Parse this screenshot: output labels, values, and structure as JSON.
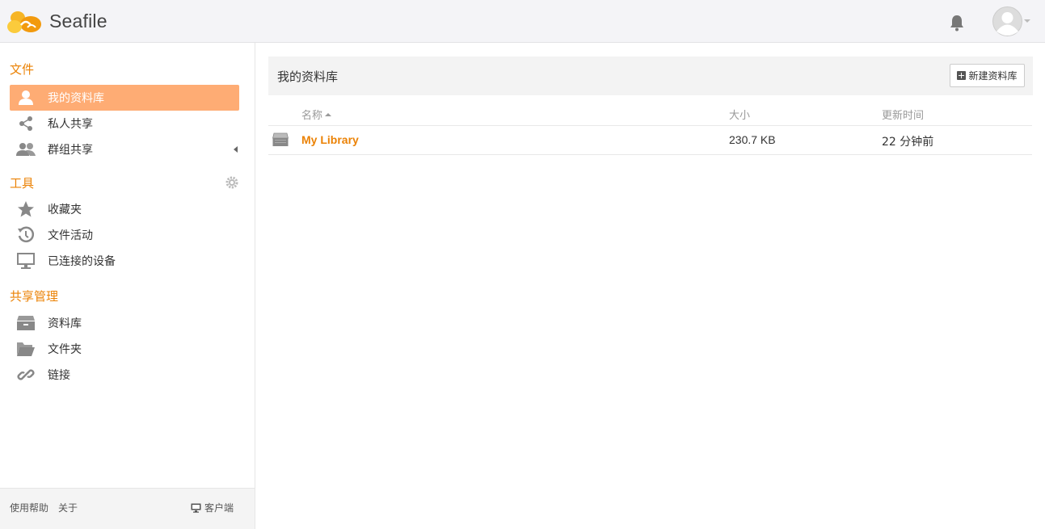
{
  "header": {
    "logo_text": "Seafile"
  },
  "sidebar": {
    "files_heading": "文件",
    "files_items": [
      {
        "label": "我的资料库",
        "icon": "user-icon",
        "active": true
      },
      {
        "label": "私人共享",
        "icon": "share-icon"
      },
      {
        "label": "群组共享",
        "icon": "group-icon"
      }
    ],
    "tools_heading": "工具",
    "tools_items": [
      {
        "label": "收藏夹",
        "icon": "star-icon"
      },
      {
        "label": "文件活动",
        "icon": "history-icon"
      },
      {
        "label": "已连接的设备",
        "icon": "monitor-icon"
      }
    ],
    "share_heading": "共享管理",
    "share_items": [
      {
        "label": "资料库",
        "icon": "library-icon"
      },
      {
        "label": "文件夹",
        "icon": "folder-icon"
      },
      {
        "label": "链接",
        "icon": "link-icon"
      }
    ],
    "footer": {
      "help": "使用帮助",
      "about": "关于",
      "client": "客户端"
    }
  },
  "main": {
    "title": "我的资料库",
    "new_button": "新建资料库",
    "columns": {
      "name": "名称",
      "size": "大小",
      "updated": "更新时间"
    },
    "rows": [
      {
        "name": "My Library",
        "size": "230.7 KB",
        "updated": "22 分钟前"
      }
    ]
  },
  "colors": {
    "accent": "#eb8205",
    "active_bg": "#feac74"
  }
}
